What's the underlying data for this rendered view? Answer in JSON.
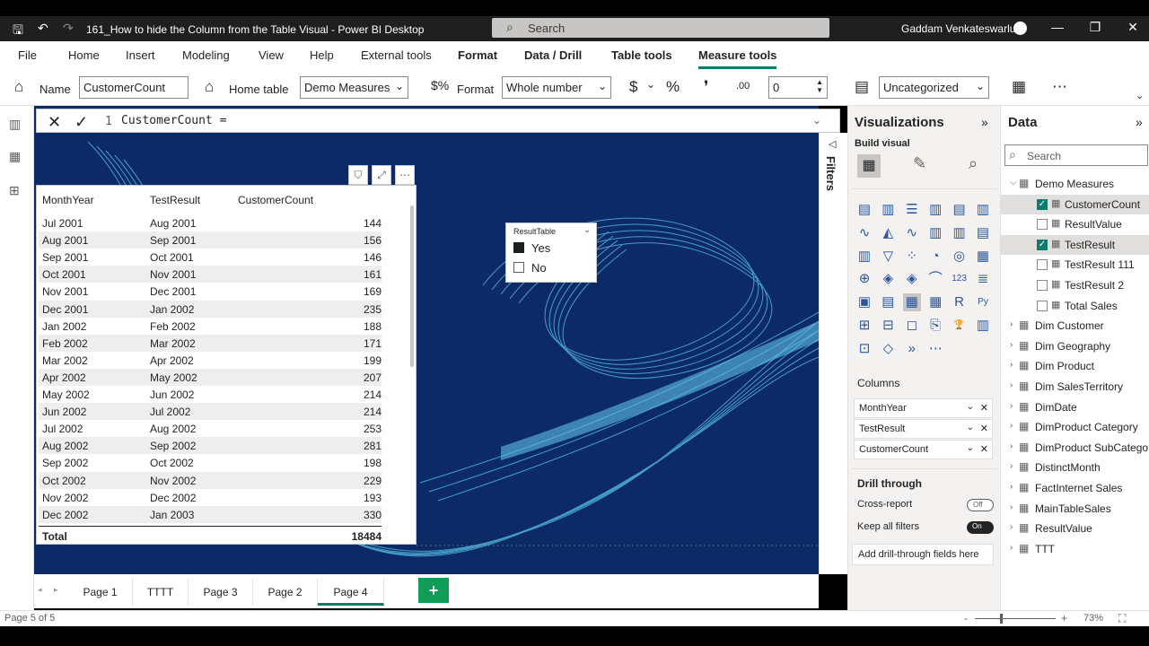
{
  "window": {
    "title": "161_How to hide the Column from the Table Visual - Power BI Desktop",
    "search_placeholder": "Search",
    "user": "Gaddam Venkateswarlu"
  },
  "menu": [
    "File",
    "Home",
    "Insert",
    "Modeling",
    "View",
    "Help",
    "External tools",
    "Format",
    "Data / Drill",
    "Table tools",
    "Measure tools"
  ],
  "ribbon": {
    "name_label": "Name",
    "name_value": "CustomerCount",
    "home_table_label": "Home table",
    "home_table_value": "Demo Measures",
    "format_label": "Format",
    "format_value": "Whole number",
    "currency_symbol": "$",
    "percent_symbol": "%",
    "comma_symbol": "❜",
    "decimal_symbol": ".00",
    "decimals_value": "0",
    "category_value": "Uncategorized"
  },
  "formula": {
    "line_number": "1",
    "code": "CustomerCount ="
  },
  "table": {
    "headers": [
      "MonthYear",
      "TestResult",
      "CustomerCount"
    ],
    "rows": [
      [
        "Jul 2001",
        "Aug 2001",
        "144"
      ],
      [
        "Aug 2001",
        "Sep 2001",
        "156"
      ],
      [
        "Sep 2001",
        "Oct 2001",
        "146"
      ],
      [
        "Oct 2001",
        "Nov 2001",
        "161"
      ],
      [
        "Nov 2001",
        "Dec 2001",
        "169"
      ],
      [
        "Dec 2001",
        "Jan 2002",
        "235"
      ],
      [
        "Jan 2002",
        "Feb 2002",
        "188"
      ],
      [
        "Feb 2002",
        "Mar 2002",
        "171"
      ],
      [
        "Mar 2002",
        "Apr 2002",
        "199"
      ],
      [
        "Apr 2002",
        "May 2002",
        "207"
      ],
      [
        "May 2002",
        "Jun 2002",
        "214"
      ],
      [
        "Jun 2002",
        "Jul 2002",
        "214"
      ],
      [
        "Jul 2002",
        "Aug 2002",
        "253"
      ],
      [
        "Aug 2002",
        "Sep 2002",
        "281"
      ],
      [
        "Sep 2002",
        "Oct 2002",
        "198"
      ],
      [
        "Oct 2002",
        "Nov 2002",
        "229"
      ],
      [
        "Nov 2002",
        "Dec 2002",
        "193"
      ],
      [
        "Dec 2002",
        "Jan 2003",
        "330"
      ]
    ],
    "total_label": "Total",
    "total_value": "18484"
  },
  "slicer": {
    "title": "ResultTable",
    "options": [
      {
        "label": "Yes",
        "checked": true
      },
      {
        "label": "No",
        "checked": false
      }
    ]
  },
  "filters_label": "Filters",
  "viz": {
    "title": "Visualizations",
    "build_visual": "Build visual",
    "columns_label": "Columns",
    "wells": [
      "MonthYear",
      "TestResult",
      "CustomerCount"
    ],
    "drill_through": "Drill through",
    "cross_report": "Cross-report",
    "cross_report_state": "Off",
    "keep_all_filters": "Keep all filters",
    "keep_all_filters_state": "On",
    "add_drill": "Add drill-through fields here"
  },
  "data": {
    "title": "Data",
    "search_placeholder": "Search",
    "measures_table": "Demo Measures",
    "measures": [
      {
        "name": "CustomerCount",
        "checked": true
      },
      {
        "name": "ResultValue",
        "checked": false
      },
      {
        "name": "TestResult",
        "checked": true
      },
      {
        "name": "TestResult 111",
        "checked": false
      },
      {
        "name": "TestResult 2",
        "checked": false
      },
      {
        "name": "Total Sales",
        "checked": false
      }
    ],
    "tables": [
      "Dim Customer",
      "Dim Geography",
      "Dim Product",
      "Dim SalesTerritory",
      "DimDate",
      "DimProduct Category",
      "DimProduct SubCatego...",
      "DistinctMonth",
      "FactInternet Sales",
      "MainTableSales",
      "ResultValue",
      "TTT"
    ]
  },
  "pages": [
    "Page 1",
    "TTTT",
    "Page 3",
    "Page 2",
    "Page 4"
  ],
  "active_page": "Page 4",
  "status": {
    "page_info": "Page 5 of 5",
    "zoom": "73%"
  },
  "colors": {
    "canvas_bg": "#0c2a66",
    "accent": "#0f7b6c",
    "add_page": "#0f9d58"
  }
}
